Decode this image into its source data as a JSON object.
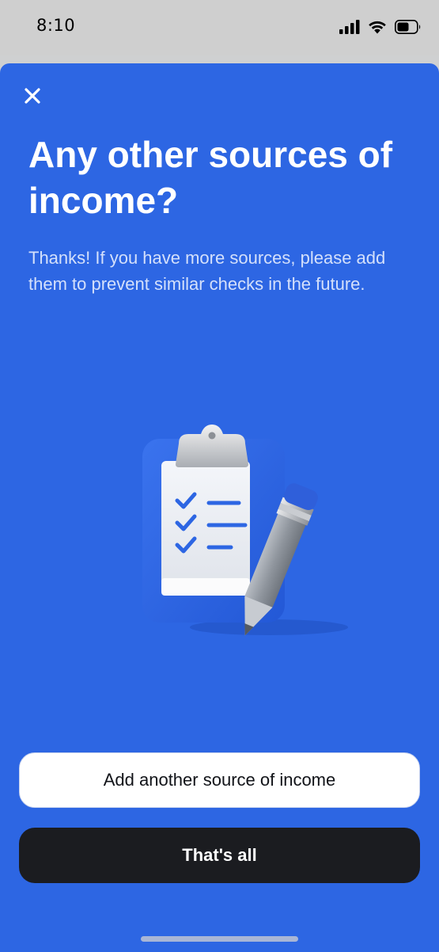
{
  "status_bar": {
    "time": "8:10"
  },
  "sheet": {
    "title": "Any other sources of income?",
    "description": "Thanks! If you have more sources, please add them to prevent similar checks in the future.",
    "secondary_button_label": "Add another source of income",
    "primary_button_label": "That's all"
  },
  "colors": {
    "sheet_background": "#2d66e3",
    "primary_button": "#1b1c20",
    "secondary_button": "#ffffff"
  },
  "icons": {
    "close": "close-icon",
    "illustration": "clipboard-checklist-pencil-illustration"
  }
}
